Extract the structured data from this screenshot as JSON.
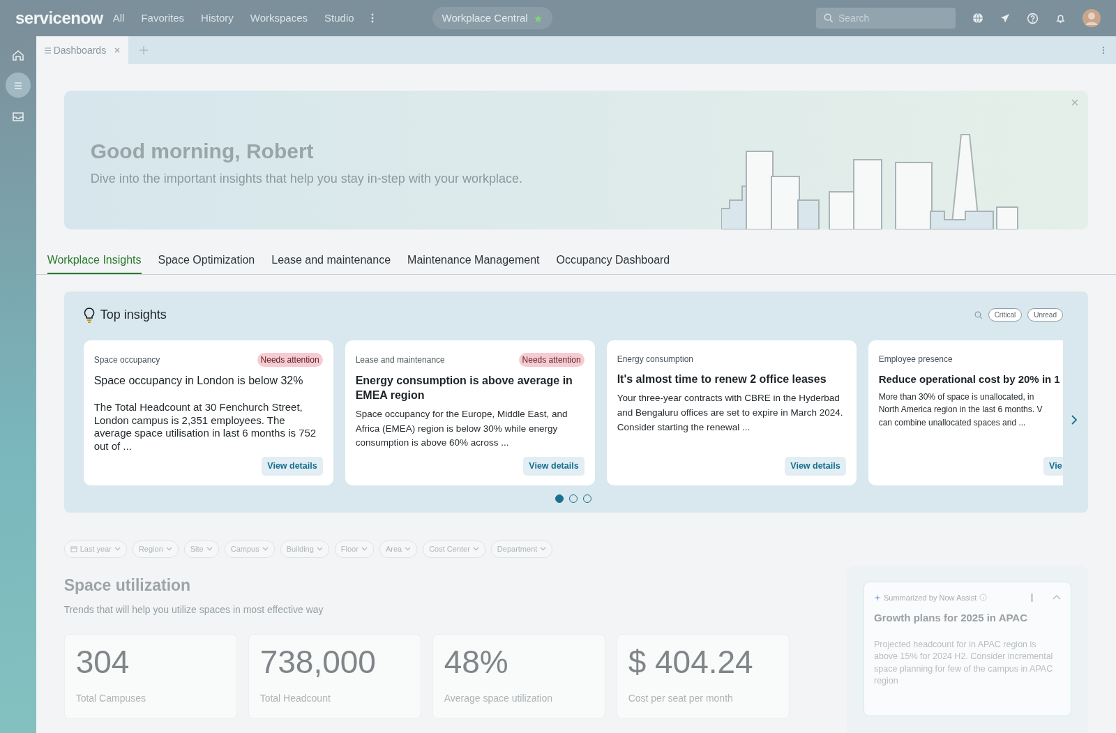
{
  "top_bar": {
    "logo": "servicenow",
    "menu": [
      "All",
      "Favorites",
      "History",
      "Workspaces",
      "Studio"
    ],
    "workspace": "Workplace Central",
    "search": {
      "placeholder": "Search"
    }
  },
  "sidebar": {
    "items": [
      {
        "selected": false
      },
      {
        "selected": true
      },
      {
        "selected": false
      }
    ]
  },
  "page_tabs": [
    {
      "label": "Dashboards",
      "selected": true
    }
  ],
  "banner": {
    "title": "Good morning, Robert",
    "subtitle": "Dive into the important insights that help you stay in-step with your workplace."
  },
  "tabs": [
    {
      "label": "Workplace Insights",
      "selected": true
    },
    {
      "label": "Space Optimization",
      "selected": false
    },
    {
      "label": "Lease and maintenance",
      "selected": false
    },
    {
      "label": "Maintenance Management",
      "selected": false
    },
    {
      "label": "Occupancy Dashboard",
      "selected": false
    }
  ],
  "insights": {
    "title": "Top insights",
    "filters": [
      {
        "label": "Critical",
        "selected": false
      },
      {
        "label": "Unread",
        "selected": false
      }
    ],
    "cards": [
      {
        "category": "Space occupancy",
        "badge": "Needs attention",
        "kind": "plain",
        "title": "Space occupancy in London is below 32%",
        "body": "The Total Headcount at 30 Fenchurch Street, London campus is 2,351 employees. The average space utilisation in last 6 months is 752 out of ...",
        "button": "View details"
      },
      {
        "category": "Lease and maintenance",
        "badge": "Needs attention",
        "kind": "bold",
        "title": "Energy consumption is above average in EMEA region",
        "body": "Space occupancy for the Europe, Middle East, and Africa (EMEA) region is below 30% while energy consumption is above 60% across ...",
        "button": "View details"
      },
      {
        "category": "Energy consumption",
        "kind": "bold",
        "title": "It's almost time to renew 2 office leases",
        "body": "Your three-year contracts with CBRE in the Hyderbad and Bengaluru offices are set to expire in March 2024. Consider starting the renewal ...",
        "button": "View details"
      },
      {
        "category": "Employee presence",
        "kind": "bold",
        "title": "Reduce operational cost by 20% in 1",
        "body": "More than 30% of space is unallocated, in\nNorth America region in the last 6 months. V\ncan combine unallocated spaces and ...",
        "button": "Vie"
      }
    ],
    "pages": [
      {
        "selected": true
      },
      {
        "selected": false
      },
      {
        "selected": false
      }
    ]
  },
  "filters": [
    {
      "label": "Last year",
      "kind": "date"
    },
    {
      "label": "Region",
      "kind": "plain"
    },
    {
      "label": "Site",
      "kind": "plain"
    },
    {
      "label": "Campus",
      "kind": "plain"
    },
    {
      "label": "Building",
      "kind": "plain"
    },
    {
      "label": "Floor",
      "kind": "plain"
    },
    {
      "label": "Area",
      "kind": "plain"
    },
    {
      "label": "Cost Center",
      "kind": "plain"
    },
    {
      "label": "Department",
      "kind": "plain"
    }
  ],
  "space_utilization": {
    "title": "Space utilization",
    "subtitle": "Trends that will help you utilize spaces in most effective way",
    "stats": [
      {
        "value": "304",
        "label": "Total Campuses"
      },
      {
        "value": "738,000",
        "label": "Total Headcount"
      },
      {
        "value": "48%",
        "label": "Average space utilization"
      },
      {
        "value": "$ 404.24",
        "label": "Cost per seat per month"
      }
    ]
  },
  "summary": {
    "source": "Summarized by Now Assist",
    "title": "Growth plans for 2025 in APAC",
    "body": "Projected headcount for in APAC region is above 15% for 2024 H2. Consider incremental space planning for few of the campus in APAC region"
  }
}
